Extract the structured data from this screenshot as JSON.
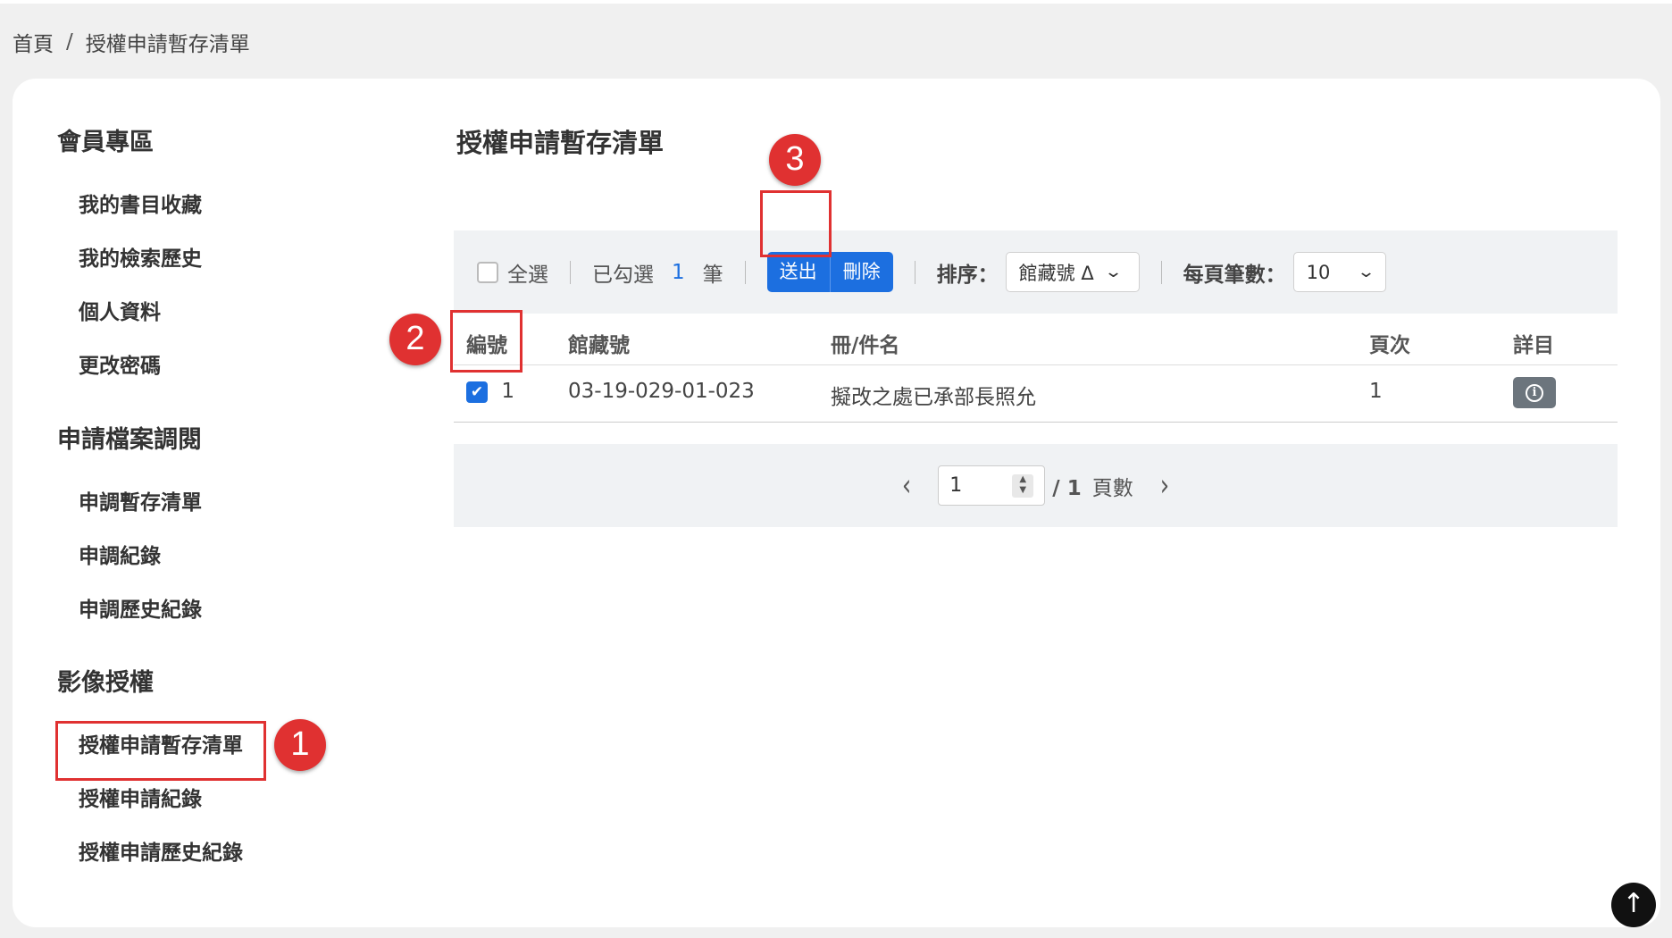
{
  "breadcrumb": {
    "home": "首頁",
    "separator": "/",
    "current": "授權申請暫存清單"
  },
  "sidebar": {
    "sections": [
      {
        "title": "會員專區",
        "items": [
          "我的書目收藏",
          "我的檢索歷史",
          "個人資料",
          "更改密碼"
        ]
      },
      {
        "title": "申請檔案調閱",
        "items": [
          "申調暫存清單",
          "申調紀錄",
          "申調歷史紀錄"
        ]
      },
      {
        "title": "影像授權",
        "items": [
          "授權申請暫存清單",
          "授權申請紀錄",
          "授權申請歷史紀錄"
        ]
      }
    ]
  },
  "main": {
    "title": "授權申請暫存清單",
    "toolbar": {
      "select_all": "全選",
      "selected_prefix": "已勾選",
      "selected_count": "1",
      "selected_suffix": "筆",
      "send_label": "送出",
      "delete_label": "刪除",
      "sort_label": "排序：",
      "sort_value": "館藏號 Δ",
      "per_page_label": "每頁筆數：",
      "per_page_value": "10"
    },
    "table": {
      "headers": [
        "編號",
        "館藏號",
        "冊/件名",
        "頁次",
        "詳目"
      ],
      "rows": [
        {
          "no": "1",
          "call_number": "03-19-029-01-023",
          "title": "擬改之處已承部長照允",
          "page": "1",
          "checked": true
        }
      ]
    },
    "pager": {
      "current": "1",
      "total_prefix": "/",
      "total": "1",
      "total_label": "頁數"
    }
  },
  "annotations": [
    "1",
    "2",
    "3"
  ],
  "colors": {
    "accent": "#1c6fe0",
    "annotation": "#e03131",
    "toolbar_bg": "#f0f2f4"
  }
}
